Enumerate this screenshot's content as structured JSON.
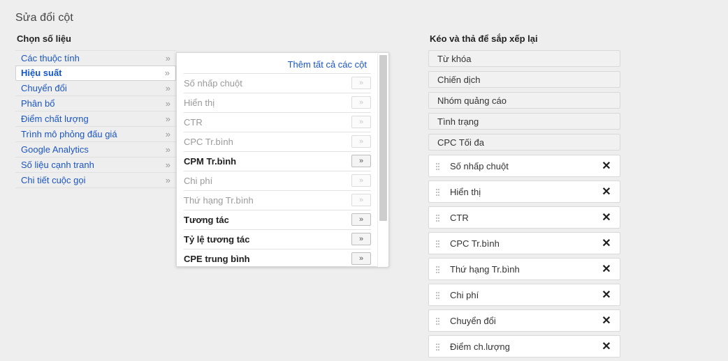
{
  "page": {
    "title": "Sửa đổi cột"
  },
  "left_panel": {
    "heading": "Chọn số liệu",
    "arrow_glyph": "»",
    "categories": [
      {
        "label": "Các thuộc tính",
        "selected": false
      },
      {
        "label": "Hiệu suất",
        "selected": true
      },
      {
        "label": "Chuyển đổi",
        "selected": false
      },
      {
        "label": "Phân bổ",
        "selected": false
      },
      {
        "label": "Điểm chất lượng",
        "selected": false
      },
      {
        "label": "Trình mô phỏng đấu giá",
        "selected": false
      },
      {
        "label": "Google Analytics",
        "selected": false
      },
      {
        "label": "Số liệu cạnh tranh",
        "selected": false
      },
      {
        "label": "Chi tiết cuộc gọi",
        "selected": false
      }
    ]
  },
  "metric_panel": {
    "add_all_label": "Thêm tất cả các cột",
    "button_glyph": "»",
    "metrics": [
      {
        "label": "Số nhấp chuột",
        "state": "disabled"
      },
      {
        "label": "Hiển thị",
        "state": "disabled"
      },
      {
        "label": "CTR",
        "state": "disabled"
      },
      {
        "label": "CPC Tr.bình",
        "state": "disabled"
      },
      {
        "label": "CPM Tr.bình",
        "state": "enabled"
      },
      {
        "label": "Chi phí",
        "state": "disabled"
      },
      {
        "label": "Thứ hạng Tr.bình",
        "state": "disabled"
      },
      {
        "label": "Tương tác",
        "state": "enabled"
      },
      {
        "label": "Tỷ lệ tương tác",
        "state": "enabled"
      },
      {
        "label": "CPE trung bình",
        "state": "enabled"
      }
    ]
  },
  "right_panel": {
    "heading": "Kéo và thả để sắp xếp lại",
    "remove_glyph": "✕",
    "selected_columns": [
      {
        "label": "Từ khóa",
        "locked": true
      },
      {
        "label": "Chiến dịch",
        "locked": true
      },
      {
        "label": "Nhóm quảng cáo",
        "locked": true
      },
      {
        "label": "Tình trạng",
        "locked": true
      },
      {
        "label": "CPC Tối đa",
        "locked": true
      },
      {
        "label": "Số nhấp chuột",
        "locked": false
      },
      {
        "label": "Hiển thị",
        "locked": false
      },
      {
        "label": "CTR",
        "locked": false
      },
      {
        "label": "CPC Tr.bình",
        "locked": false
      },
      {
        "label": "Thứ hạng Tr.bình",
        "locked": false
      },
      {
        "label": "Chi phí",
        "locked": false
      },
      {
        "label": "Chuyển đổi",
        "locked": false
      },
      {
        "label": "Điểm ch.lượng",
        "locked": false
      }
    ]
  },
  "colors": {
    "link": "#1a55c4",
    "selected_text": "#1155cc",
    "page_bg": "#eeeeee",
    "panel_bg": "#ffffff",
    "locked_bg": "#f1f1f1"
  }
}
